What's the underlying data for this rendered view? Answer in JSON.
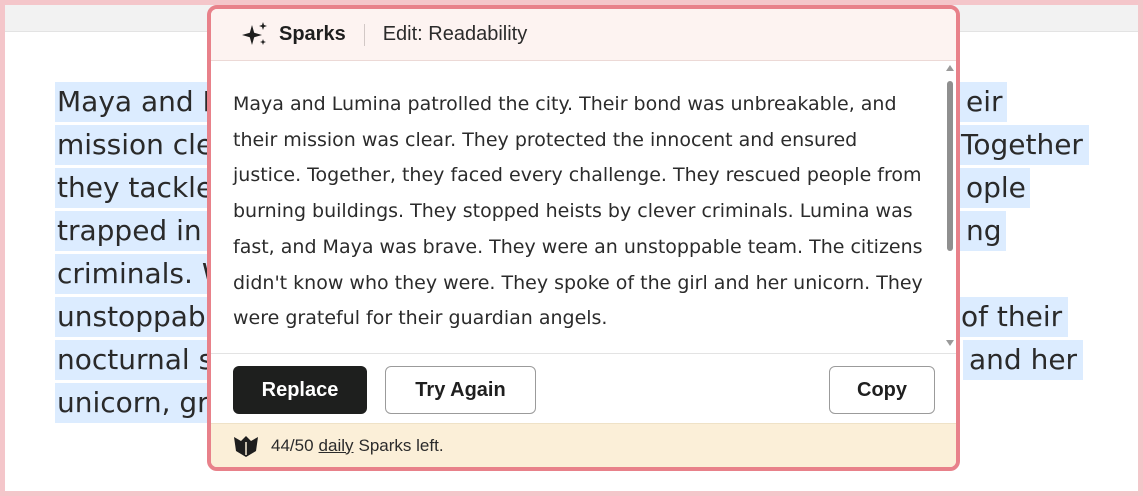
{
  "document": {
    "lines": [
      "Maya and L",
      "mission cle",
      "they tackle",
      "trapped in b",
      "criminals. W",
      "unstoppabl",
      "nocturnal s",
      "unicorn, gra"
    ],
    "right_fragments": [
      "eir",
      "Together",
      "ople",
      "ng",
      "",
      "of their",
      "and her",
      ""
    ]
  },
  "popup": {
    "brand": "Sparks",
    "edit_label": "Edit: Readability",
    "body_text": "Maya and Lumina patrolled the city. Their bond was unbreakable, and their mission was clear. They protected the innocent and ensured justice. Together, they faced every challenge. They rescued people from burning buildings. They stopped heists by clever criminals. Lumina was fast, and Maya was brave. They were an unstoppable team. The citizens didn't know who they were. They spoke of the girl and her unicorn. They were grateful for their guardian angels.",
    "buttons": {
      "replace": "Replace",
      "try_again": "Try Again",
      "copy": "Copy"
    },
    "footer": {
      "count": "44/50",
      "daily": "daily",
      "suffix": "Sparks left."
    }
  },
  "colors": {
    "border_pink": "#e8818a",
    "highlight": "#dcecff",
    "replace_bg": "#1e1f1e",
    "footer_bg": "#fbefd8"
  },
  "icons": {
    "brand": "sparkle-icon",
    "footer": "bird-logo-icon"
  }
}
